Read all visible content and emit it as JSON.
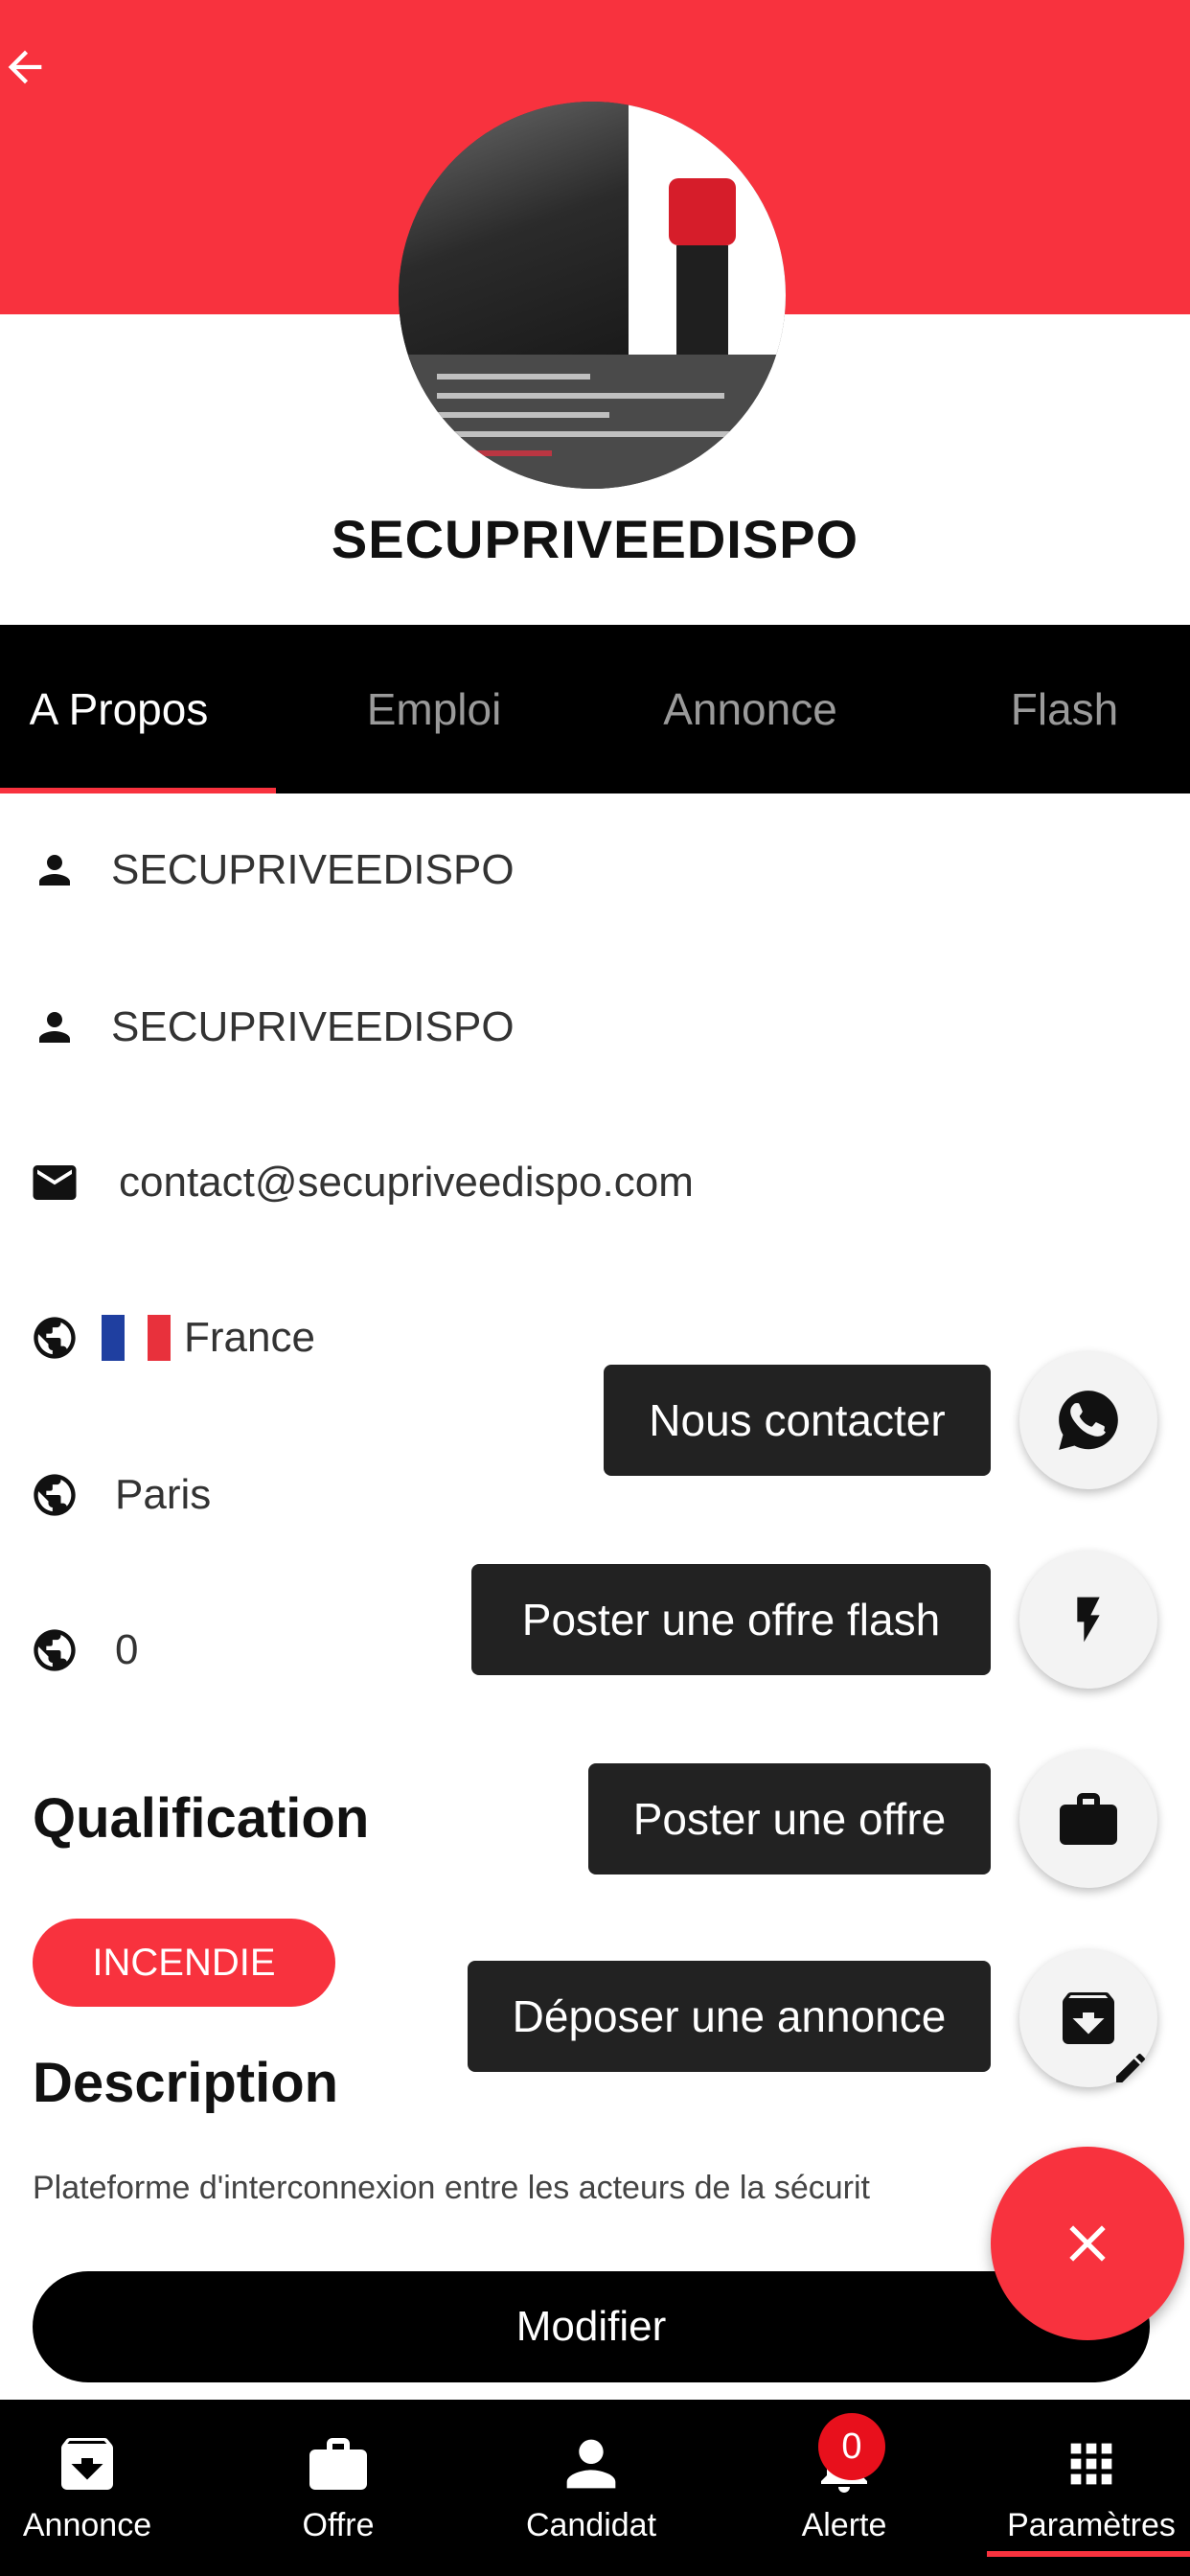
{
  "profile": {
    "name": "SECUPRIVEEDISPO"
  },
  "tabs": [
    {
      "label": "A Propos",
      "active": true
    },
    {
      "label": "Emploi",
      "active": false
    },
    {
      "label": "Annonce",
      "active": false
    },
    {
      "label": "Flash",
      "active": false
    }
  ],
  "about": {
    "first_name": "SECUPRIVEEDISPO",
    "last_name": "SECUPRIVEEDISPO",
    "email": "contact@secupriveedispo.com",
    "country": "France",
    "city": "Paris",
    "extra_value": "0"
  },
  "qualification": {
    "title": "Qualification",
    "chip": "INCENDIE"
  },
  "description": {
    "title": "Description",
    "text": "Plateforme d'interconnexion entre les acteurs de la sécurit"
  },
  "modify_button": "Modifier",
  "fab_actions": [
    {
      "label": "Nous contacter",
      "icon": "whatsapp-icon"
    },
    {
      "label": "Poster une offre flash",
      "icon": "flash-icon"
    },
    {
      "label": "Poster une offre",
      "icon": "briefcase-icon"
    },
    {
      "label": "Déposer une annonce",
      "icon": "archive-icon"
    }
  ],
  "bottom_nav": [
    {
      "label": "Annonce",
      "icon": "archive-icon"
    },
    {
      "label": "Offre",
      "icon": "briefcase-icon"
    },
    {
      "label": "Candidat",
      "icon": "person-icon"
    },
    {
      "label": "Alerte",
      "icon": "bell-icon",
      "badge": "0"
    },
    {
      "label": "Paramètres",
      "icon": "grid-icon",
      "active": true
    }
  ],
  "colors": {
    "accent": "#f8323e",
    "dark": "#000000"
  }
}
